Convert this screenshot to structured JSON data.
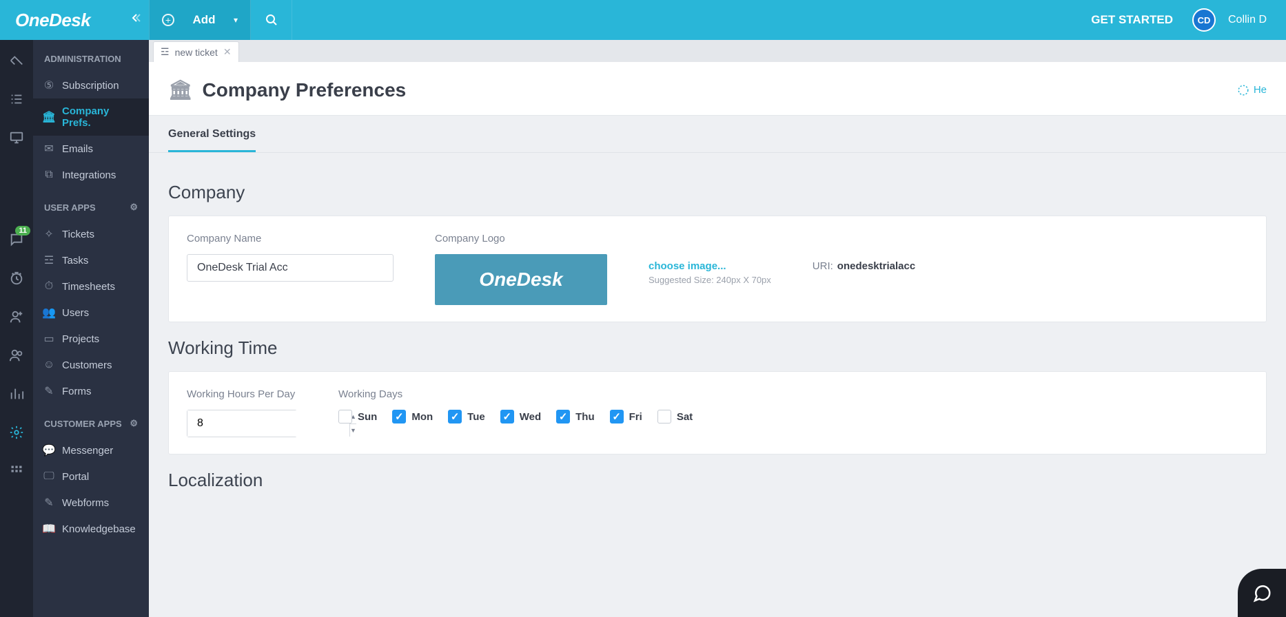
{
  "header": {
    "logo": "OneDesk",
    "add_label": "Add",
    "get_started": "GET STARTED",
    "avatar_initials": "CD",
    "username": "Collin D"
  },
  "rail": {
    "message_badge": "11"
  },
  "sidebar": {
    "admin_title": "ADMINISTRATION",
    "admin": {
      "subscription": "Subscription",
      "company_prefs": "Company Prefs.",
      "emails": "Emails",
      "integrations": "Integrations"
    },
    "user_apps_title": "USER APPS",
    "user": {
      "tickets": "Tickets",
      "tasks": "Tasks",
      "timesheets": "Timesheets",
      "users": "Users",
      "projects": "Projects",
      "customers": "Customers",
      "forms": "Forms"
    },
    "customer_apps_title": "CUSTOMER APPS",
    "customer": {
      "messenger": "Messenger",
      "portal": "Portal",
      "webforms": "Webforms",
      "knowledgebase": "Knowledgebase"
    }
  },
  "tab": {
    "label": "new ticket"
  },
  "page": {
    "title": "Company Preferences",
    "help": "He",
    "subtab": "General Settings"
  },
  "company": {
    "heading": "Company",
    "name_label": "Company Name",
    "name_value": "OneDesk Trial Acc",
    "logo_label": "Company Logo",
    "logo_text": "OneDesk",
    "choose_image": "choose image...",
    "suggested": "Suggested Size: 240px X 70px",
    "uri_label": "URI:",
    "uri_value": "onedesktrialacc"
  },
  "working": {
    "heading": "Working Time",
    "hours_label": "Working Hours Per Day",
    "hours_value": "8",
    "days_label": "Working Days",
    "days": [
      {
        "label": "Sun",
        "checked": false
      },
      {
        "label": "Mon",
        "checked": true
      },
      {
        "label": "Tue",
        "checked": true
      },
      {
        "label": "Wed",
        "checked": true
      },
      {
        "label": "Thu",
        "checked": true
      },
      {
        "label": "Fri",
        "checked": true
      },
      {
        "label": "Sat",
        "checked": false
      }
    ]
  },
  "localization": {
    "heading": "Localization"
  }
}
